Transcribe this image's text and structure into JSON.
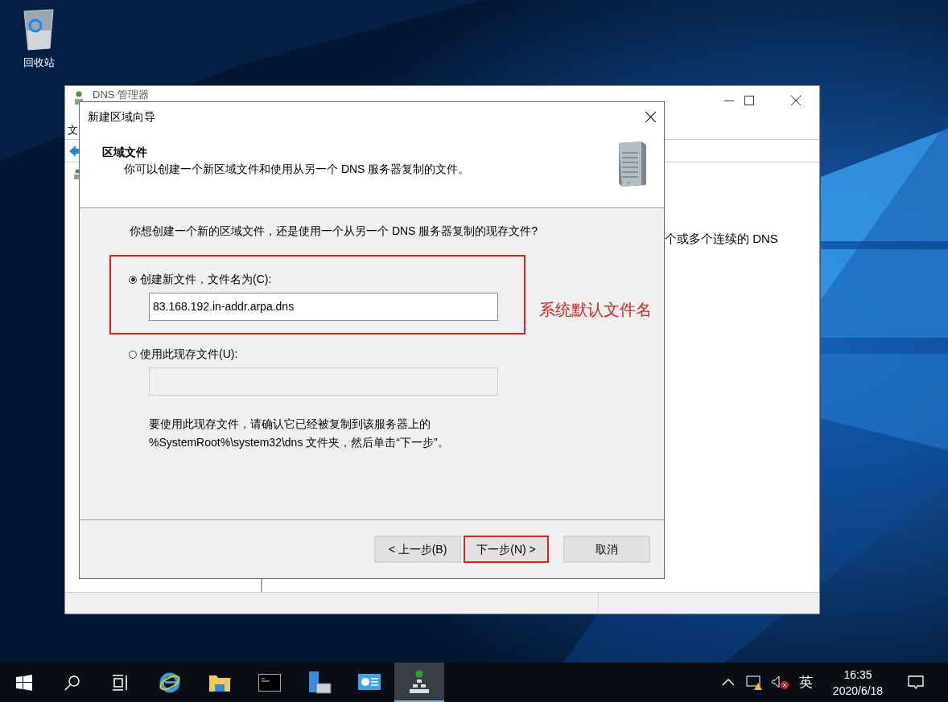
{
  "desktop": {
    "icons": [
      {
        "label": "回收站"
      }
    ]
  },
  "background_window": {
    "title": "DNS 管理器",
    "menu": [
      "文"
    ],
    "right_pane_text": "个或多个连续的 DNS"
  },
  "dialog": {
    "title": "新建区域向导",
    "header_title": "区域文件",
    "header_subtitle": "你可以创建一个新区域文件和使用从另一个 DNS 服务器复制的文件。",
    "question": "你想创建一个新的区域文件，还是使用一个从另一个 DNS 服务器复制的现存文件?",
    "options": [
      {
        "label": "创建新文件，文件名为(C):",
        "selected": true,
        "value": "83.168.192.in-addr.arpa.dns",
        "highlighted": true
      },
      {
        "label": "使用此现存文件(U):",
        "selected": false,
        "highlighted": false
      }
    ],
    "note_lines": [
      "要使用此现存文件，请确认它已经被复制到该服务器上的",
      "%SystemRoot%\\system32\\dns 文件夹，然后单击“下一步”。"
    ],
    "buttons": [
      {
        "label": "< 上一步(B)",
        "highlighted": false
      },
      {
        "label": "下一步(N) >",
        "highlighted": true
      },
      {
        "label": "取消",
        "highlighted": false
      }
    ]
  },
  "annotation": {
    "text": "系统默认文件名"
  },
  "taskbar": {
    "apps": [
      {
        "kind": "ie",
        "selected": false
      },
      {
        "kind": "folder",
        "selected": false
      },
      {
        "kind": "terminal",
        "selected": false
      },
      {
        "kind": "server",
        "selected": false
      },
      {
        "kind": "panel",
        "selected": false
      },
      {
        "kind": "dns",
        "selected": true
      }
    ],
    "ime": "英",
    "time": "16:35",
    "date": "2020/6/18"
  }
}
